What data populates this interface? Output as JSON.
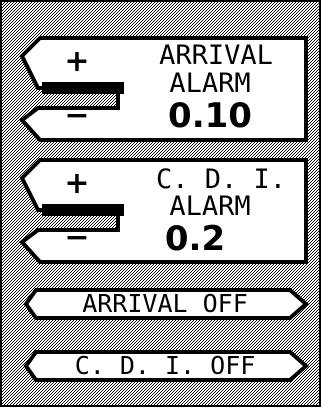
{
  "arrival_alarm": {
    "plus_label": "+",
    "minus_label": "−",
    "title_line1": "ARRIVAL",
    "title_line2": "ALARM",
    "value": "0.10"
  },
  "cdi_alarm": {
    "plus_label": "+",
    "minus_label": "−",
    "title_line1": "C. D. I.",
    "title_line2": "ALARM",
    "value": "0.2"
  },
  "buttons": {
    "arrival_off": "ARRIVAL OFF",
    "cdi_off": "C. D. I. OFF"
  },
  "colors": {
    "background": "#ffffff",
    "ink": "#000000",
    "frame_pattern": "dotted-gray"
  }
}
